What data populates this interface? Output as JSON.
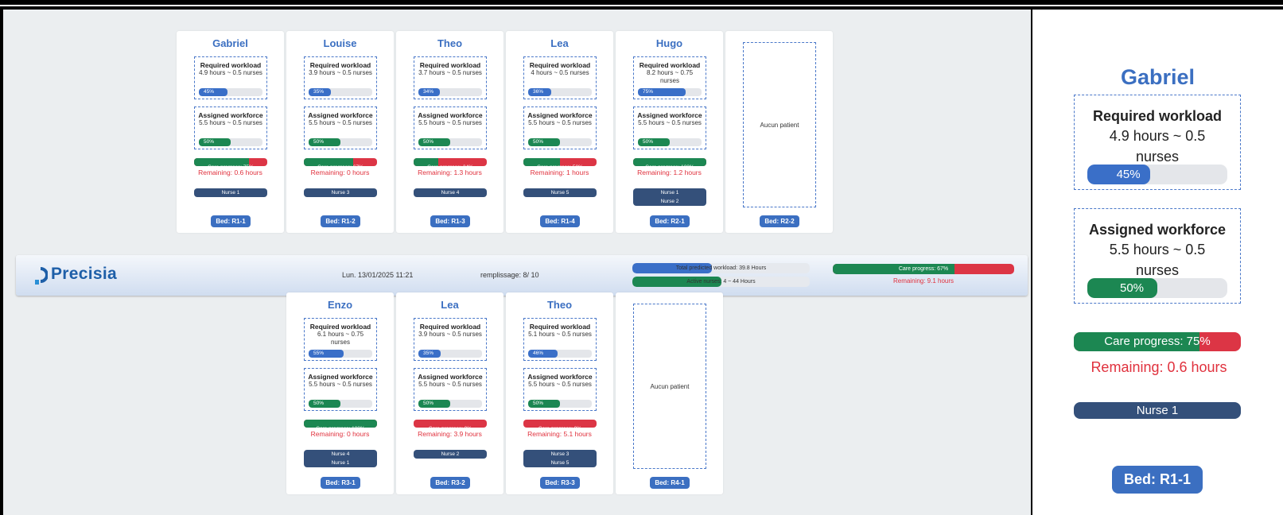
{
  "header": {
    "logo_text": "Precisia",
    "date": "Lun. 13/01/2025 11:21",
    "fill_label": "remplissage: 8/ 10",
    "predicted_workload": {
      "text": "Total predicted workload: 39.8 Hours",
      "fraction": 0.45
    },
    "active_nurses": {
      "text": "Active nurses: 4 ~ 44 Hours",
      "fraction": 0.5
    },
    "care_progress": {
      "text": "Care progress: 67%",
      "fraction": 0.67
    },
    "remaining": "Remaining: 9.1 hours"
  },
  "colors": {
    "accent": "#3b6fc1",
    "progress_green": "#1c8752",
    "alert_red": "#dc3545",
    "nurse_navy": "#34507a"
  },
  "labels": {
    "required_title": "Required workload",
    "assigned_title": "Assigned workforce",
    "empty_text": "Aucun patient"
  },
  "top_row": [
    {
      "name": "Gabriel",
      "req_text": "4.9 hours ~ 0.5 nurses",
      "req_pct": "45%",
      "req_frac": 0.45,
      "asg_text": "5.5 hours ~ 0.5 nurses",
      "asg_pct": "50%",
      "asg_frac": 0.5,
      "care_text": "Care progress: 75%",
      "care_frac": 0.75,
      "remaining": "Remaining: 0.6 hours",
      "nurses": [
        "Nurse 1"
      ],
      "bed": "Bed: R1-1"
    },
    {
      "name": "Louise",
      "req_text": "3.9 hours ~ 0.5 nurses",
      "req_pct": "35%",
      "req_frac": 0.35,
      "asg_text": "5.5 hours ~ 0.5 nurses",
      "asg_pct": "50%",
      "asg_frac": 0.5,
      "care_text": "Care progress: 67%",
      "care_frac": 0.67,
      "remaining": "Remaining: 0 hours",
      "nurses": [
        "Nurse 3"
      ],
      "bed": "Bed: R1-2"
    },
    {
      "name": "Theo",
      "req_text": "3.7 hours ~ 0.5 nurses",
      "req_pct": "34%",
      "req_frac": 0.34,
      "asg_text": "5.5 hours ~ 0.5 nurses",
      "asg_pct": "50%",
      "asg_frac": 0.5,
      "care_text": "Care progress: 34%",
      "care_frac": 0.34,
      "remaining": "Remaining: 1.3 hours",
      "nurses": [
        "Nurse 4"
      ],
      "bed": "Bed: R1-3"
    },
    {
      "name": "Lea",
      "req_text": "4 hours ~ 0.5 nurses",
      "req_pct": "36%",
      "req_frac": 0.36,
      "asg_text": "5.5 hours ~ 0.5 nurses",
      "asg_pct": "50%",
      "asg_frac": 0.5,
      "care_text": "Care progress: 50%",
      "care_frac": 0.5,
      "remaining": "Remaining: 1 hours",
      "nurses": [
        "Nurse 5"
      ],
      "bed": "Bed: R1-4"
    },
    {
      "name": "Hugo",
      "req_text": "8.2 hours ~ 0.75 nurses",
      "req_pct": "75%",
      "req_frac": 0.75,
      "asg_text": "5.5 hours ~ 0.5 nurses",
      "asg_pct": "50%",
      "asg_frac": 0.5,
      "care_text": "Care progress: 100%",
      "care_frac": 1.0,
      "remaining": "Remaining: 1.2 hours",
      "nurses": [
        "Nurse 1",
        "Nurse 2"
      ],
      "bed": "Bed: R2-1"
    },
    {
      "empty": true,
      "bed": "Bed: R2-2"
    }
  ],
  "bottom_row": [
    {
      "name": "Enzo",
      "req_text": "6.1 hours ~ 0.75 nurses",
      "req_pct": "55%",
      "req_frac": 0.55,
      "asg_text": "5.5 hours ~ 0.5 nurses",
      "asg_pct": "50%",
      "asg_frac": 0.5,
      "care_text": "Care progress: 100%",
      "care_frac": 1.0,
      "remaining": "Remaining: 0 hours",
      "nurses": [
        "Nurse 4",
        "Nurse 1"
      ],
      "bed": "Bed: R3-1"
    },
    {
      "name": "Lea",
      "req_text": "3.9 hours ~ 0.5 nurses",
      "req_pct": "35%",
      "req_frac": 0.35,
      "asg_text": "5.5 hours ~ 0.5 nurses",
      "asg_pct": "50%",
      "asg_frac": 0.5,
      "care_text": "Care progress: 0%",
      "care_frac": 0.0,
      "remaining": "Remaining: 3.9 hours",
      "nurses": [
        "Nurse 2"
      ],
      "bed": "Bed: R3-2"
    },
    {
      "name": "Theo",
      "req_text": "5.1 hours ~ 0.5 nurses",
      "req_pct": "46%",
      "req_frac": 0.46,
      "asg_text": "5.5 hours ~ 0.5 nurses",
      "asg_pct": "50%",
      "asg_frac": 0.5,
      "care_text": "Care progress: 0%",
      "care_frac": 0.0,
      "remaining": "Remaining: 5.1 hours",
      "nurses": [
        "Nurse 3",
        "Nurse 5"
      ],
      "bed": "Bed: R3-3"
    },
    {
      "empty": true,
      "bed": "Bed: R4-1"
    }
  ],
  "detail": {
    "name": "Gabriel",
    "req_title": "Required workload",
    "req_text": "4.9 hours ~ 0.5 nurses",
    "req_pct": "45%",
    "req_frac": 0.45,
    "asg_title": "Assigned workforce",
    "asg_text": "5.5 hours ~ 0.5 nurses",
    "asg_pct": "50%",
    "asg_frac": 0.5,
    "care_text": "Care progress: 75%",
    "care_frac": 0.75,
    "remaining": "Remaining: 0.6 hours",
    "nurse": "Nurse 1",
    "bed": "Bed: R1-1"
  }
}
